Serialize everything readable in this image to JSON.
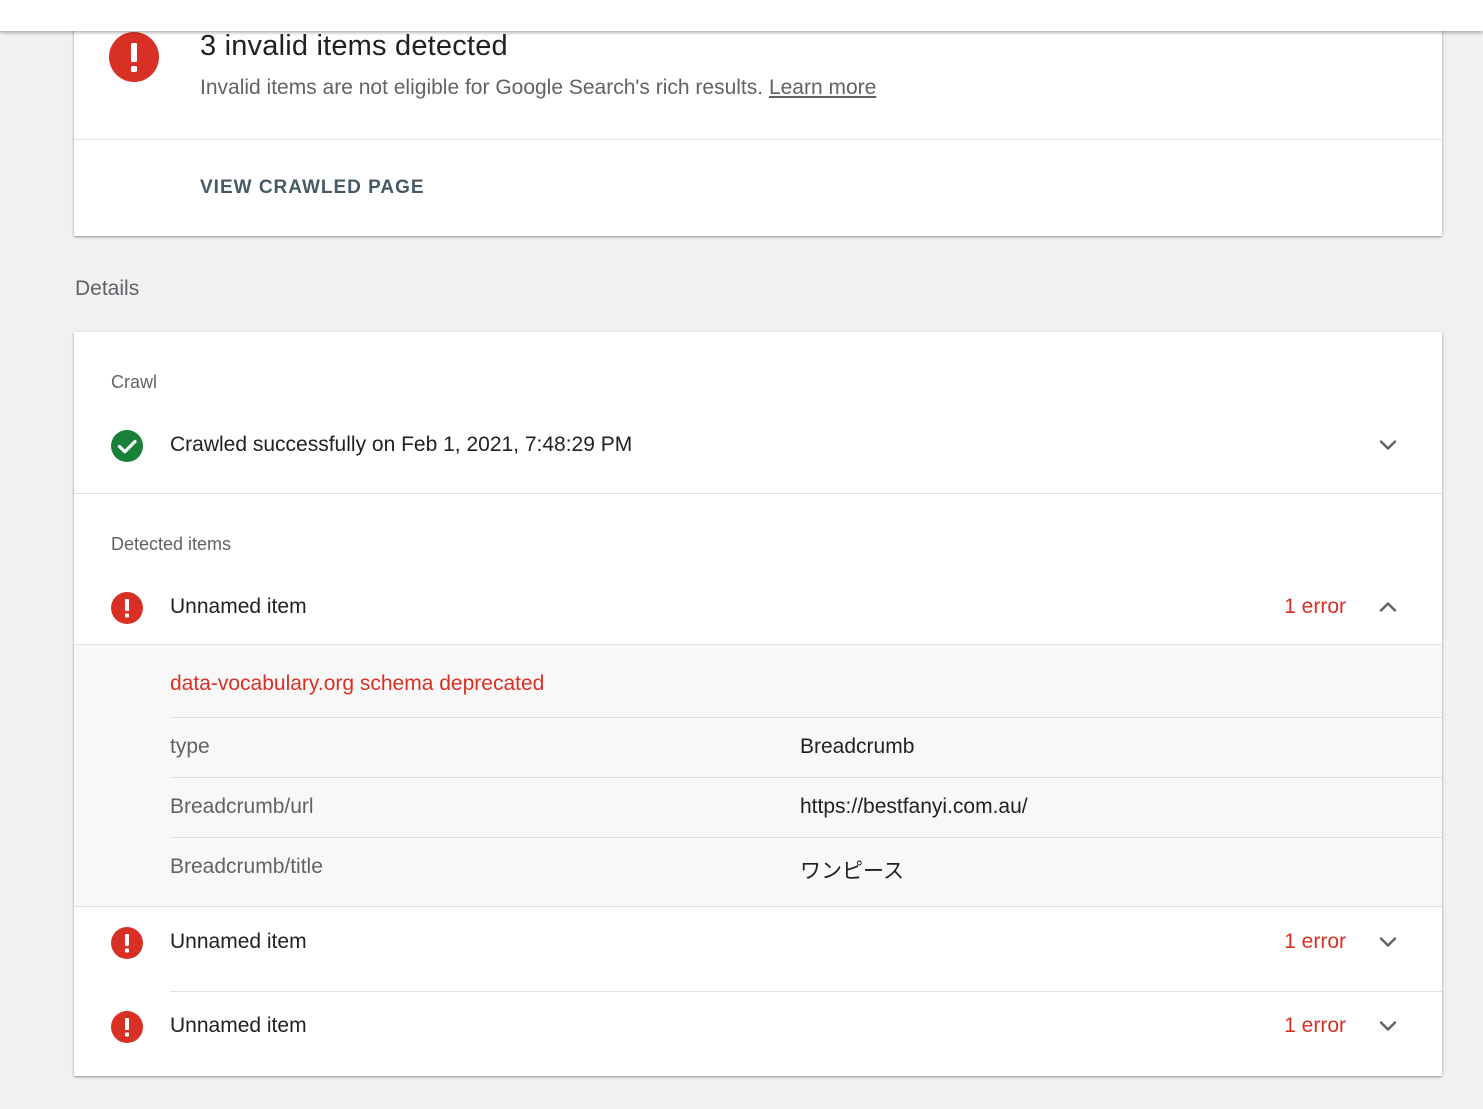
{
  "summary": {
    "title": "3 invalid items detected",
    "subtitle": "Invalid items are not eligible for Google Search's rich results.",
    "learn_more": "Learn more",
    "action": "VIEW CRAWLED PAGE",
    "icon": "error-icon"
  },
  "details": {
    "label": "Details",
    "crawl": {
      "label": "Crawl",
      "status_text": "Crawled successfully on Feb 1, 2021, 7:48:29 PM",
      "icon": "check-circle-icon"
    },
    "detected": {
      "label": "Detected items",
      "items": [
        {
          "name": "Unnamed item",
          "count": "1 error",
          "expanded": true,
          "issue": "data-vocabulary.org schema deprecated",
          "properties": [
            {
              "key": "type",
              "value": "Breadcrumb"
            },
            {
              "key": "Breadcrumb/url",
              "value": "https://bestfanyi.com.au/"
            },
            {
              "key": "Breadcrumb/title",
              "value": "ワンピース"
            }
          ]
        },
        {
          "name": "Unnamed item",
          "count": "1 error",
          "expanded": false
        },
        {
          "name": "Unnamed item",
          "count": "1 error",
          "expanded": false
        }
      ]
    }
  },
  "colors": {
    "error": "#d93025",
    "success": "#188038",
    "action": "#455a64",
    "background": "#f1f1f1"
  }
}
